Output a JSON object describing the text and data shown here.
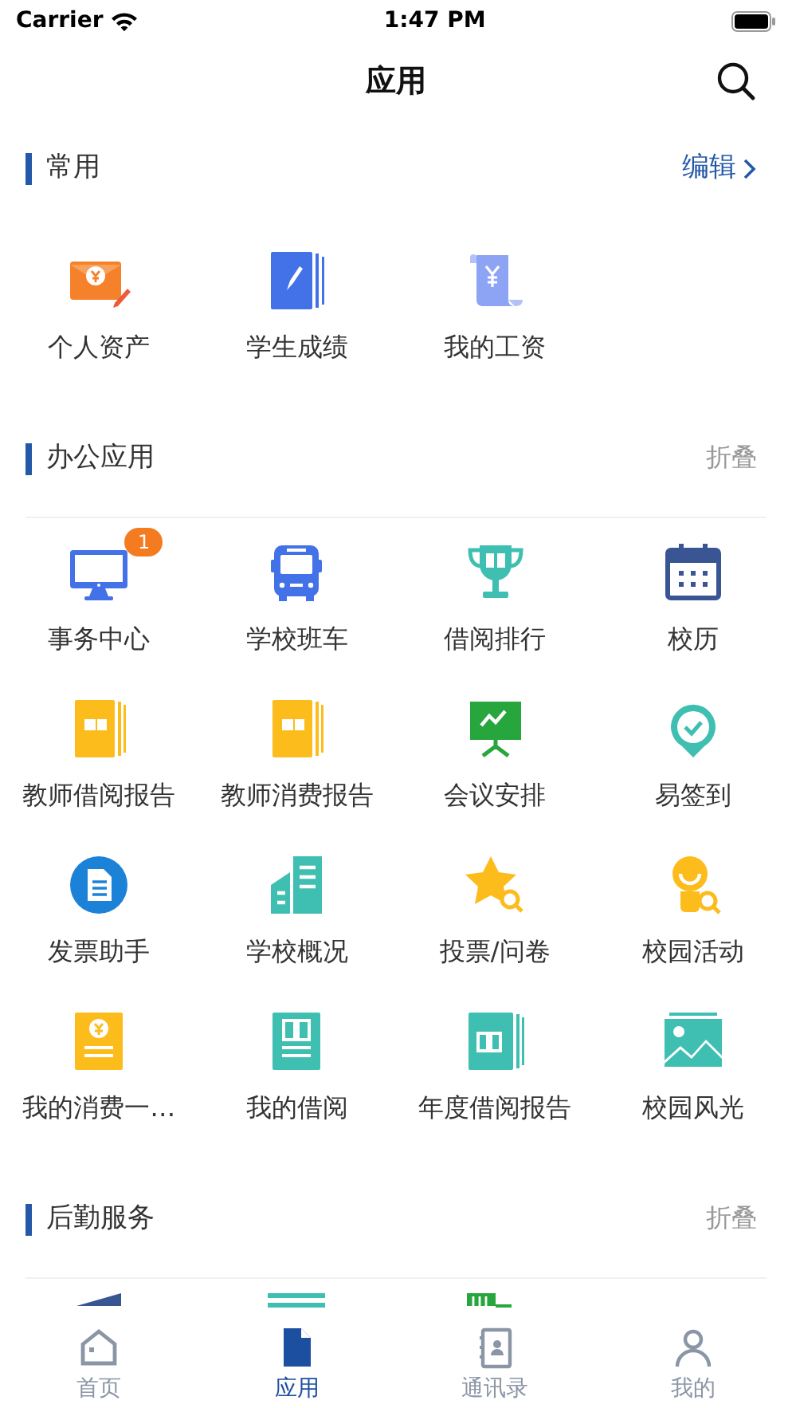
{
  "status_bar": {
    "carrier": "Carrier",
    "time": "1:47 PM"
  },
  "nav": {
    "title": "应用"
  },
  "sections": [
    {
      "title": "常用",
      "action": {
        "kind": "edit",
        "label": "编辑"
      },
      "items": [
        {
          "label": "个人资产",
          "kind": "redpacket"
        },
        {
          "label": "学生成绩",
          "kind": "notebook"
        },
        {
          "label": "我的工资",
          "kind": "scroll"
        }
      ]
    },
    {
      "title": "办公应用",
      "action": {
        "kind": "collapse",
        "label": "折叠"
      },
      "items": [
        {
          "label": "事务中心",
          "kind": "monitor",
          "badge": "1"
        },
        {
          "label": "学校班车",
          "kind": "bus"
        },
        {
          "label": "借阅排行",
          "kind": "trophy"
        },
        {
          "label": "校历",
          "kind": "calendar"
        },
        {
          "label": "教师借阅报告",
          "kind": "yellowbook"
        },
        {
          "label": "教师消费报告",
          "kind": "yellowbook"
        },
        {
          "label": "会议安排",
          "kind": "presentation"
        },
        {
          "label": "易签到",
          "kind": "checkpin"
        },
        {
          "label": "发票助手",
          "kind": "invoice"
        },
        {
          "label": "学校概况",
          "kind": "building"
        },
        {
          "label": "投票/问卷",
          "kind": "starsearch"
        },
        {
          "label": "校园活动",
          "kind": "personsearch"
        },
        {
          "label": "我的消费一…",
          "kind": "coincard"
        },
        {
          "label": "我的借阅",
          "kind": "tealbook"
        },
        {
          "label": "年度借阅报告",
          "kind": "tealbooks"
        },
        {
          "label": "校园风光",
          "kind": "image"
        }
      ]
    },
    {
      "title": "后勤服务",
      "action": {
        "kind": "collapse",
        "label": "折叠"
      },
      "items": [
        {
          "kind": "peek1"
        },
        {
          "kind": "peek2"
        },
        {
          "kind": "peek3"
        }
      ]
    }
  ],
  "tabs": [
    {
      "label": "首页",
      "kind": "home",
      "selected": false
    },
    {
      "label": "应用",
      "kind": "doc",
      "selected": true
    },
    {
      "label": "通讯录",
      "kind": "contacts",
      "selected": false
    },
    {
      "label": "我的",
      "kind": "person",
      "selected": false
    }
  ]
}
